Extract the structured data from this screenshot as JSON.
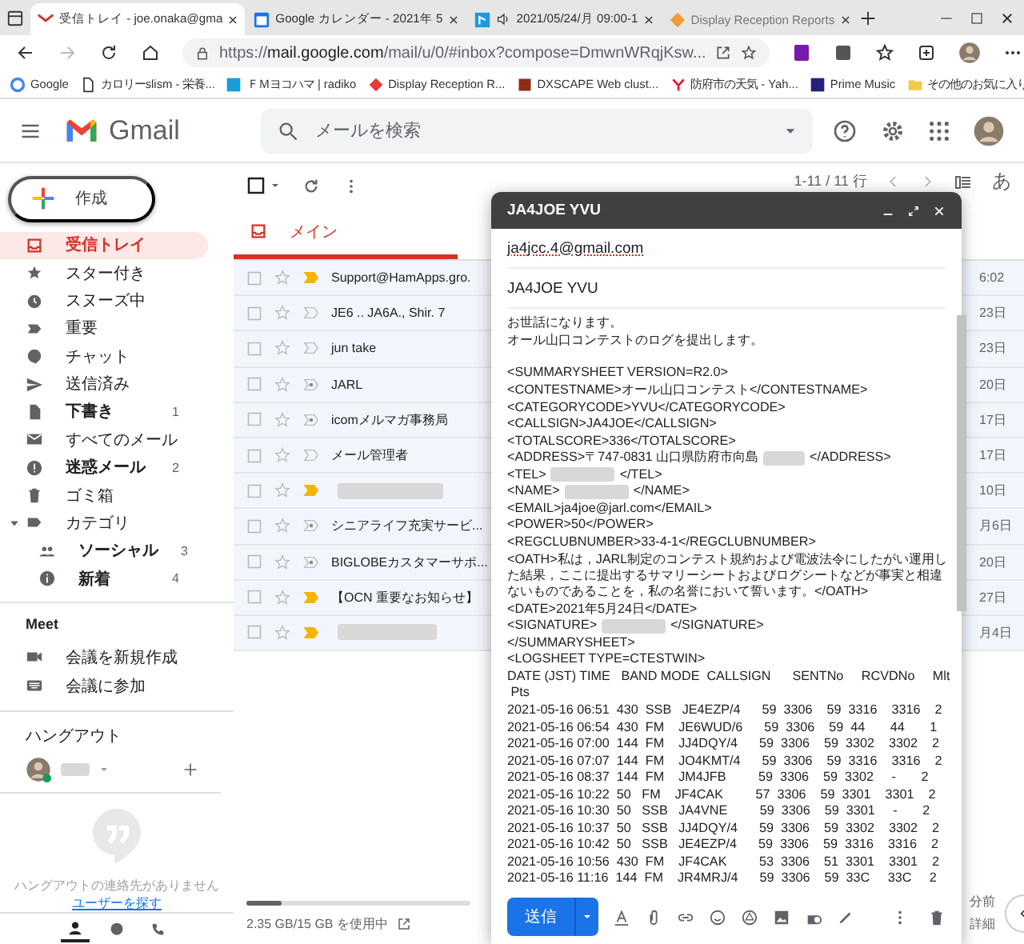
{
  "browser": {
    "tabs": [
      {
        "title": "受信トレイ - joe.onaka@gma",
        "selected": true
      },
      {
        "title": "Google カレンダー - 2021年 5",
        "selected": false
      },
      {
        "title": "2021/05/24/月 09:00-1",
        "selected": false
      },
      {
        "title": "Display Reception Reports",
        "selected": false
      }
    ],
    "url": "https://**mail.google.com**/mail/u/0/#inbox?compose=DmwnWRqjKsw...",
    "bookmarks": [
      "Google",
      "カロリーslism - 栄養...",
      "ＦＭヨコハマ | radiko",
      "Display Reception R...",
      "DXSCAPE Web clust...",
      "防府市の天気 - Yah...",
      "Prime Music"
    ],
    "other_bookmarks": "その他のお気に入り"
  },
  "gmail": {
    "logo": "Gmail",
    "search": {
      "placeholder": "メールを検索"
    },
    "compose_button": "作成"
  },
  "sidebar": {
    "items": [
      {
        "label": "受信トレイ",
        "selected": true,
        "bold": false
      },
      {
        "label": "スター付き",
        "selected": false,
        "bold": false
      },
      {
        "label": "スヌーズ中",
        "selected": false,
        "bold": false
      },
      {
        "label": "重要",
        "selected": false,
        "bold": false
      },
      {
        "label": "チャット",
        "selected": false,
        "bold": false
      },
      {
        "label": "送信済み",
        "selected": false,
        "bold": false
      },
      {
        "label": "下書き",
        "selected": false,
        "bold": true,
        "count": "1"
      },
      {
        "label": "すべてのメール",
        "selected": false,
        "bold": false
      },
      {
        "label": "迷惑メール",
        "selected": false,
        "bold": true,
        "count": "2"
      },
      {
        "label": "ゴミ箱",
        "selected": false,
        "bold": false
      },
      {
        "label": "カテゴリ",
        "selected": false,
        "bold": false,
        "expanded": true,
        "children": [
          {
            "label": "ソーシャル",
            "selected": false,
            "bold": true,
            "count": "3"
          },
          {
            "label": "新着",
            "selected": false,
            "bold": true,
            "count": "4"
          }
        ]
      }
    ]
  },
  "meet": {
    "title": "Meet",
    "items": [
      "会議を新規作成",
      "会議に参加"
    ]
  },
  "hangouts": {
    "title": "ハングアウト",
    "empty_text": "ハングアウトの連絡先がありません",
    "link": "ユーザーを探す"
  },
  "toolbar": {
    "range": "1-11 / 11 行",
    "input_tool": "あ"
  },
  "category_tabs": [
    {
      "label": "メイン",
      "selected": true
    }
  ],
  "emails": [
    {
      "sender": "Support@HamApps.gro.",
      "important": true,
      "suggested": false,
      "date": "6:02"
    },
    {
      "sender": "JE6 .. JA6A., Shir. 7",
      "important": false,
      "suggested": false,
      "date": "23日"
    },
    {
      "sender": "jun take",
      "important": false,
      "suggested": false,
      "date": "23日"
    },
    {
      "sender": "JARL",
      "important": false,
      "suggested": true,
      "date": "20日"
    },
    {
      "sender": "icomメルマガ事務局",
      "important": false,
      "suggested": true,
      "date": "17日"
    },
    {
      "sender": "メール管理者",
      "important": false,
      "suggested": false,
      "date": "17日"
    },
    {
      "redacted": true,
      "important": true,
      "suggested": false,
      "date": "10日"
    },
    {
      "sender": "シニアライフ充実サービ...",
      "important": false,
      "suggested": true,
      "date": "月6日"
    },
    {
      "sender": "BIGLOBEカスタマーサポ...",
      "important": false,
      "suggested": true,
      "date": "20日"
    },
    {
      "sender": "【OCN 重要なお知らせ】",
      "important": true,
      "suggested": false,
      "date": "27日"
    },
    {
      "redacted": true,
      "important": true,
      "suggested": false,
      "date": "月4日"
    }
  ],
  "storage": {
    "text": "2.35 GB/15 GB を使用中",
    "level": 0.16
  },
  "activity": {
    "ago": "分前",
    "details": "詳細"
  },
  "compose": {
    "title": "JA4JOE YVU",
    "to": "ja4jcc.4@gmail.com",
    "subject": "JA4JOE YVU",
    "send": "送信",
    "greeting": [
      "お世話になります。",
      "オール山口コンテストのログを提出します。"
    ],
    "body": [
      "<SUMMARYSHEET VERSION=R2.0>",
      "<CONTESTNAME>オール山口コンテスト</CONTESTNAME>",
      "<CATEGORYCODE>YVU</CATEGORYCODE>",
      "<CALLSIGN>JA4JOE</CALLSIGN>",
      "<TOTALSCORE>336</TOTALSCORE>",
      [
        "<ADDRESS>〒747-0831 山口県防府市向島",
        "</ADDRESS>"
      ],
      [
        "<TEL>",
        "</TEL>"
      ],
      [
        "<NAME>",
        "</NAME>"
      ],
      "<EMAIL>ja4joe@jarl.com</EMAIL>",
      "<POWER>50</POWER>",
      "<REGCLUBNUMBER>33-4-1</REGCLUBNUMBER>",
      "<OATH>私は，JARL制定のコンテスト規約および電波法令にしたがい運用した結果，ここに提出するサマリーシートおよびログシートなどが事実と相違ないものであることを，私の名誉において誓います。</OATH>",
      "<DATE>2021年5月24日</DATE>",
      [
        "<SIGNATURE>",
        "</SIGNATURE>"
      ],
      "</SUMMARYSHEET>",
      "<LOGSHEET TYPE=CTESTWIN>",
      "DATE (JST) TIME   BAND MODE  CALLSIGN      SENTNo     RCVDNo     Mlt",
      " Pts",
      "2021-05-16 06:51  430  SSB   JE4EZP/4      59  3306    59  3316    3316    2",
      "2021-05-16 06:54  430  FM    JE6WUD/6      59  3306    59  44       44       1",
      "2021-05-16 07:00  144  FM    JJ4DQY/4      59  3306    59  3302    3302    2",
      "2021-05-16 07:07  144  FM    JO4KMT/4      59  3306    59  3316    3316    2",
      "2021-05-16 08:37  144  FM    JM4JFB         59  3306    59  3302     -       2",
      "2021-05-16 10:22  50   FM    JF4CAK         57  3306    59  3301    3301    2",
      "2021-05-16 10:30  50   SSB   JA4VNE         59  3306    59  3301     -       2",
      "2021-05-16 10:37  50   SSB   JJ4DQY/4      59  3306    59  3302    3302    2",
      "2021-05-16 10:42  50   SSB   JE4EZP/4      59  3306    59  3316    3316    2",
      "2021-05-16 10:56  430  FM    JF4CAK         53  3306    51  3301    3301    2",
      "2021-05-16 11:16  144  FM    JR4MRJ/4      59  3306    59  33C     33C     2"
    ]
  }
}
